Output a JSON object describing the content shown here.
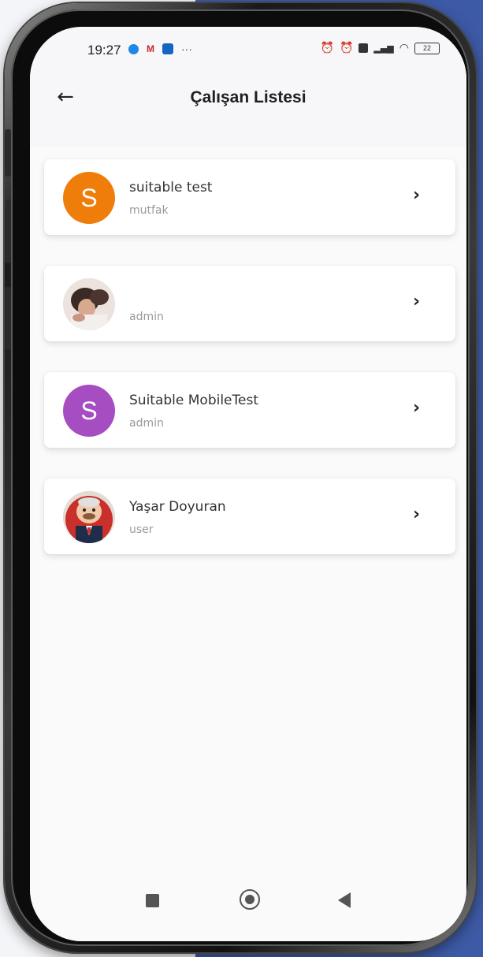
{
  "status_bar": {
    "time": "19:27",
    "left_icons": [
      "telegram-icon",
      "gmail-icon",
      "linkedin-icon",
      "more-dots-icon"
    ],
    "more": "···",
    "right_icons": [
      "alarm-off-icon",
      "alarm-icon",
      "sim-icon",
      "signal-icon",
      "wifi-icon",
      "battery-icon"
    ],
    "battery": "22"
  },
  "app_bar": {
    "title": "Çalışan Listesi",
    "back_icon": "arrow-left-icon"
  },
  "employees": [
    {
      "name": "suitable test",
      "role": "mutfak",
      "avatar_type": "initial",
      "avatar_letter": "S",
      "avatar_color": "#ef7d0a"
    },
    {
      "name": "",
      "role": "admin",
      "avatar_type": "photo",
      "avatar_letter": "",
      "avatar_color": "#d9c8c0"
    },
    {
      "name": "Suitable MobileTest",
      "role": "admin",
      "avatar_type": "initial",
      "avatar_letter": "S",
      "avatar_color": "#a64dc2"
    },
    {
      "name": "Yaşar Doyuran",
      "role": "user",
      "avatar_type": "illustration",
      "avatar_letter": "",
      "avatar_color": "#c8bdb0"
    }
  ],
  "chevron_icon": "chevron-right-icon",
  "nav_bar": [
    "recents-button",
    "home-button",
    "back-button"
  ],
  "colors": {
    "backdrop_blue": "#3d5aa6",
    "screen_bg": "#fafafa",
    "card_bg": "#ffffff",
    "title": "#1f1f1f",
    "role_text": "#9a9a9a"
  }
}
